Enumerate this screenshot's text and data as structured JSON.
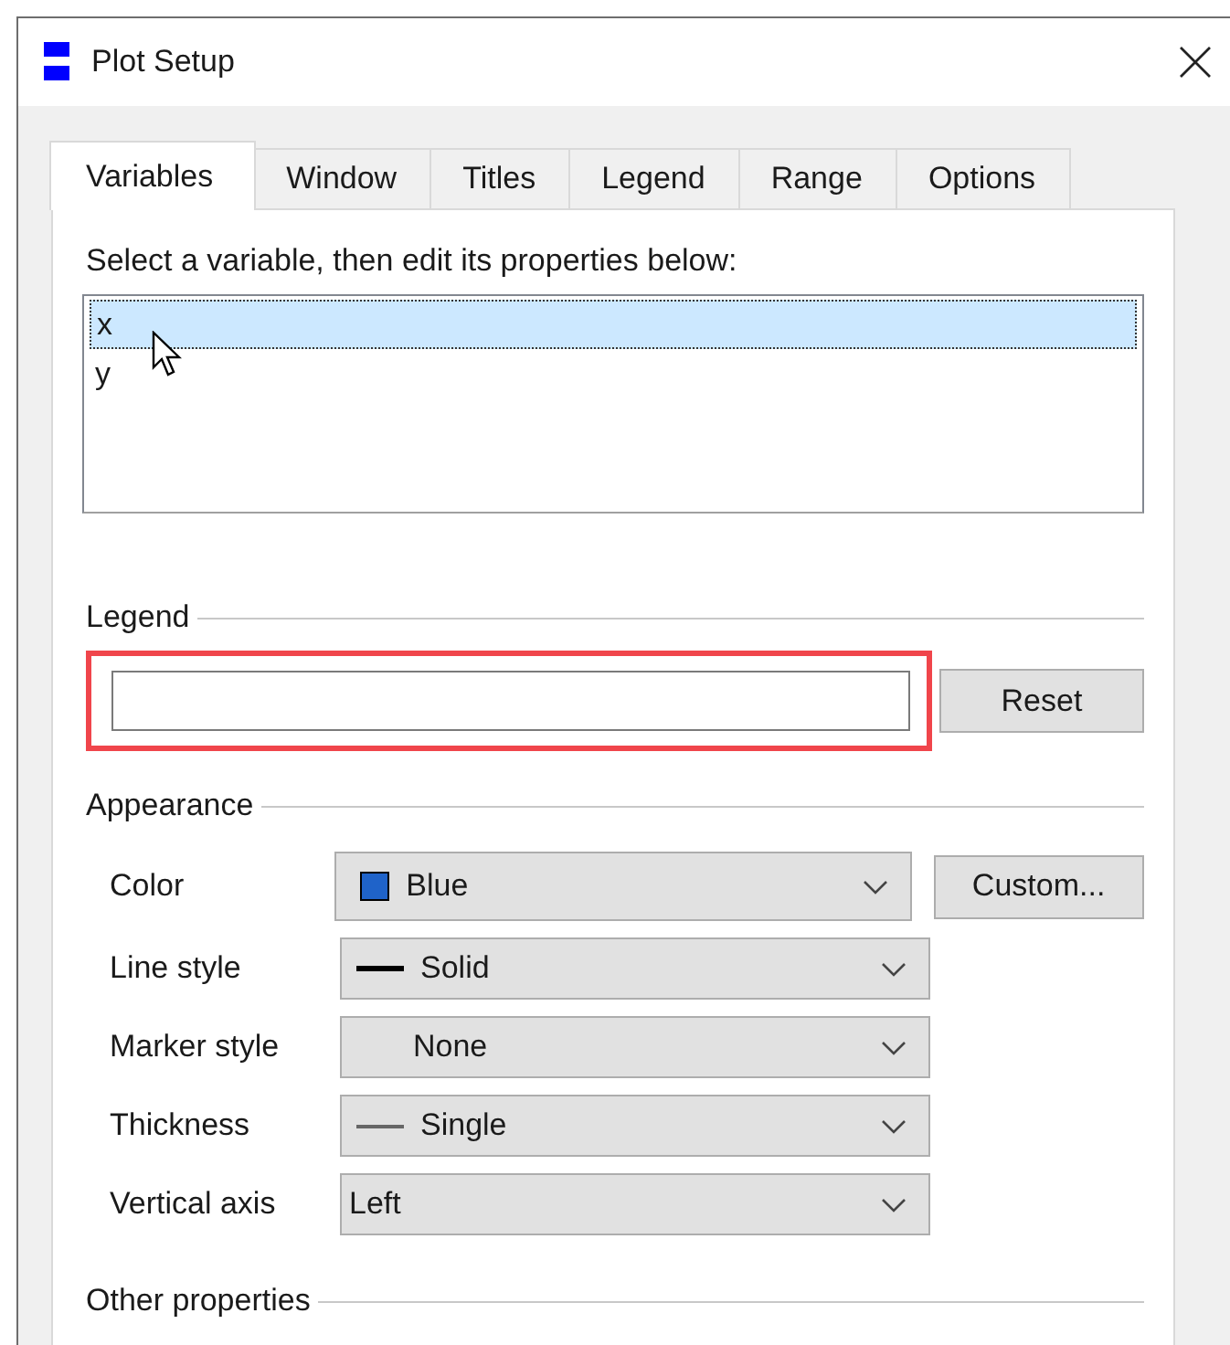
{
  "window": {
    "title": "Plot Setup"
  },
  "tabs": [
    {
      "label": "Variables",
      "selected": true
    },
    {
      "label": "Window",
      "selected": false
    },
    {
      "label": "Titles",
      "selected": false
    },
    {
      "label": "Legend",
      "selected": false
    },
    {
      "label": "Range",
      "selected": false
    },
    {
      "label": "Options",
      "selected": false
    }
  ],
  "instruction": "Select a variable, then edit its properties below:",
  "variables": [
    {
      "name": "x",
      "selected": true
    },
    {
      "name": "y",
      "selected": false
    }
  ],
  "legend": {
    "heading": "Legend",
    "highlighted": true,
    "reset_button": "Reset"
  },
  "appearance": {
    "heading": "Appearance",
    "rows": [
      {
        "label": "Color",
        "value": "Blue",
        "kind": "swatch",
        "color": "#1f63c9",
        "button": "Custom..."
      },
      {
        "label": "Line style",
        "value": "Solid",
        "kind": "thick-line"
      },
      {
        "label": "Marker style",
        "value": "None",
        "kind": "blank"
      },
      {
        "label": "Thickness",
        "value": "Single",
        "kind": "thin-line"
      },
      {
        "label": "Vertical axis",
        "value": "Left",
        "kind": "plain"
      }
    ]
  },
  "other": {
    "heading": "Other properties"
  }
}
